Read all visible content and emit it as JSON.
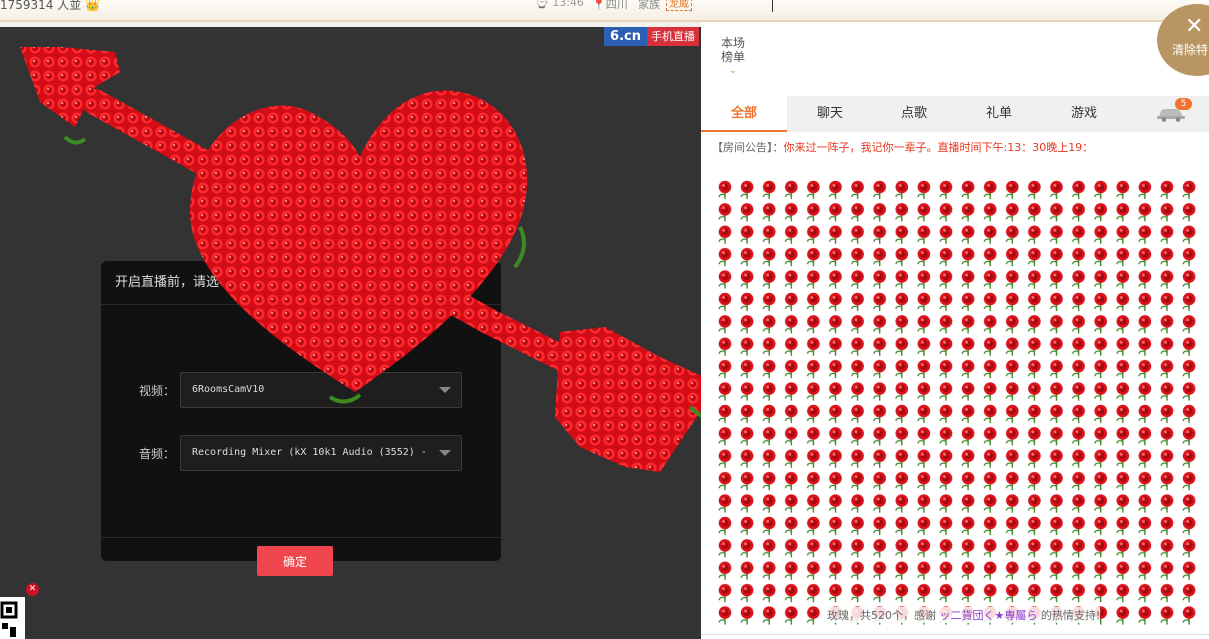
{
  "topbar": {
    "viewer_count": "1759314 人並 👑",
    "clock": "⌚ 13:46",
    "location": "📍四川",
    "family_label": "家族",
    "family_badge": "龙威"
  },
  "video": {
    "logo_brand": "6.cn",
    "logo_tag": "手机直播"
  },
  "dialog": {
    "title": "开启直播前，请选",
    "video_label": "视频：",
    "video_value": "6RoomsCamV10",
    "audio_label": "音频：",
    "audio_value": "Recording Mixer (kX 10k1 Audio (3552) -",
    "ok_label": "确定"
  },
  "panel": {
    "rank_label_1": "本场",
    "rank_label_2": "榜单",
    "rank_chevron": "⌄",
    "clear_icon": "✕",
    "clear_label": "清除特",
    "tabs": [
      {
        "label": "全部"
      },
      {
        "label": "聊天"
      },
      {
        "label": "点歌"
      },
      {
        "label": "礼单"
      },
      {
        "label": "游戏"
      }
    ],
    "car_badge": "5",
    "notice_key": "【房间公告】：",
    "notice_value": "你来过一阵子，我记你一辈子。直播时间下午:13：30晚上19：",
    "gift_prefix": "玫瑰，共520个，感谢",
    "gift_user": "ッ二貨団く★専屬ら",
    "gift_suffix": "的热情支持!"
  },
  "colors": {
    "accent": "#f0742f",
    "rose": "#e0141c",
    "ok_button": "#f0474e",
    "gold": "#b99563"
  }
}
